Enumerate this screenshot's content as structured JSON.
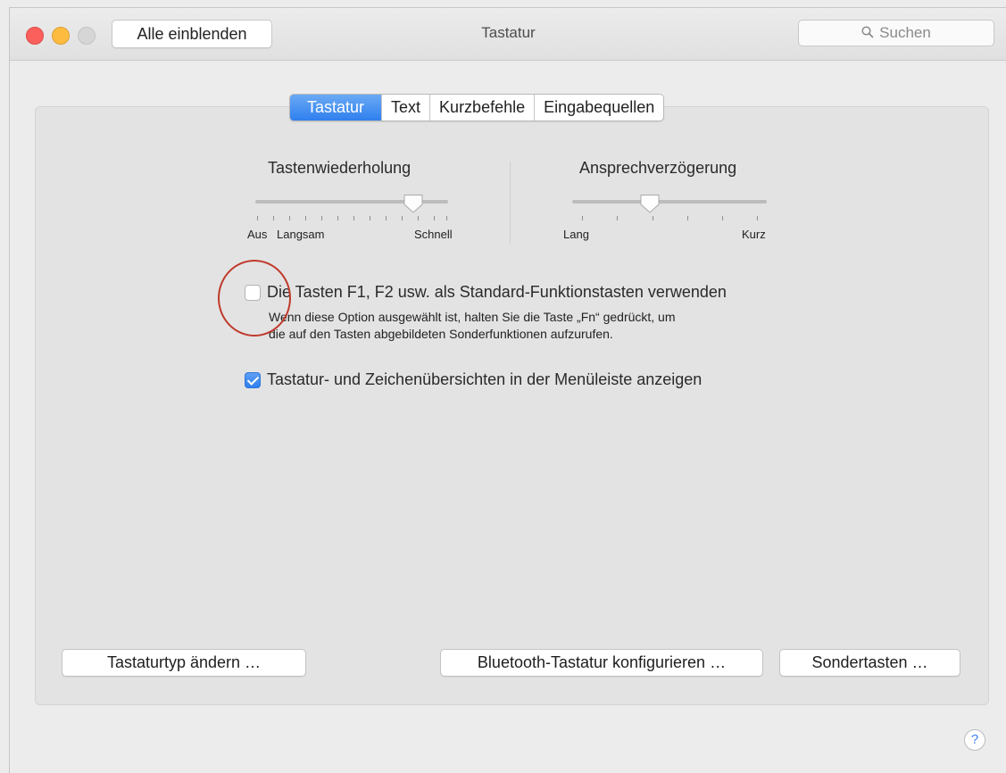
{
  "window": {
    "title": "Tastatur",
    "show_all_label": "Alle einblenden",
    "search_placeholder": "Suchen"
  },
  "tabs": [
    {
      "label": "Tastatur",
      "active": true
    },
    {
      "label": "Text",
      "active": false
    },
    {
      "label": "Kurzbefehle",
      "active": false
    },
    {
      "label": "Eingabequellen",
      "active": false
    }
  ],
  "key_repeat": {
    "title": "Tastenwiederholung",
    "min_label": "Aus",
    "slow_label": "Langsam",
    "max_label": "Schnell",
    "value_fraction": 0.82
  },
  "delay_until_repeat": {
    "title": "Ansprechverzögerung",
    "min_label": "Lang",
    "max_label": "Kurz",
    "value_fraction": 0.4
  },
  "options": {
    "fn_keys": {
      "label": "Die Tasten F1, F2 usw. als Standard-Funktionstasten verwenden",
      "description_line1": "Wenn diese Option ausgewählt ist, halten Sie die Taste „Fn“ gedrückt, um",
      "description_line2": "die auf den Tasten abgebildeten Sonderfunktionen aufzurufen.",
      "checked": false
    },
    "show_viewers": {
      "label": "Tastatur- und Zeichenübersichten in der Menüleiste anzeigen",
      "checked": true
    }
  },
  "buttons": {
    "change_type": "Tastaturtyp ändern …",
    "bluetooth": "Bluetooth-Tastatur konfigurieren …",
    "modifier_keys": "Sondertasten …"
  },
  "help_label": "?",
  "colors": {
    "accent": "#2f7fee",
    "annotation_circle": "#c0392b"
  }
}
